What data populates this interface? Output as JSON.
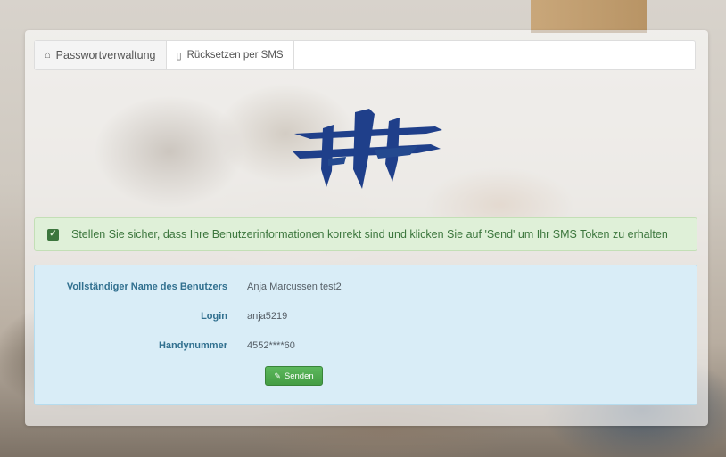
{
  "tabs": [
    {
      "label": "Passwortverwaltung",
      "icon": "home-icon"
    },
    {
      "label": "Rücksetzen per SMS",
      "icon": "mobile-icon"
    }
  ],
  "alert": {
    "text": "Stellen Sie sicher, dass Ihre Benutzerinformationen korrekt sind und klicken Sie auf 'Send' um Ihr SMS Token zu erhalten",
    "icon": "checkbox-checked-icon"
  },
  "user_info": {
    "fullname_label": "Vollständiger Name des Benutzers",
    "fullname_value": "Anja Marcussen test2",
    "login_label": "Login",
    "login_value": "anja5219",
    "phone_label": "Handynummer",
    "phone_value": "4552****60"
  },
  "send_button": {
    "label": "Senden",
    "icon": "edit-icon"
  },
  "colors": {
    "logo_blue": "#1f3f8a",
    "alert_bg": "#dff0d8",
    "alert_text": "#3c763d",
    "info_bg": "#d9edf7",
    "label_text": "#31708f",
    "button_green": "#5cb85c"
  }
}
